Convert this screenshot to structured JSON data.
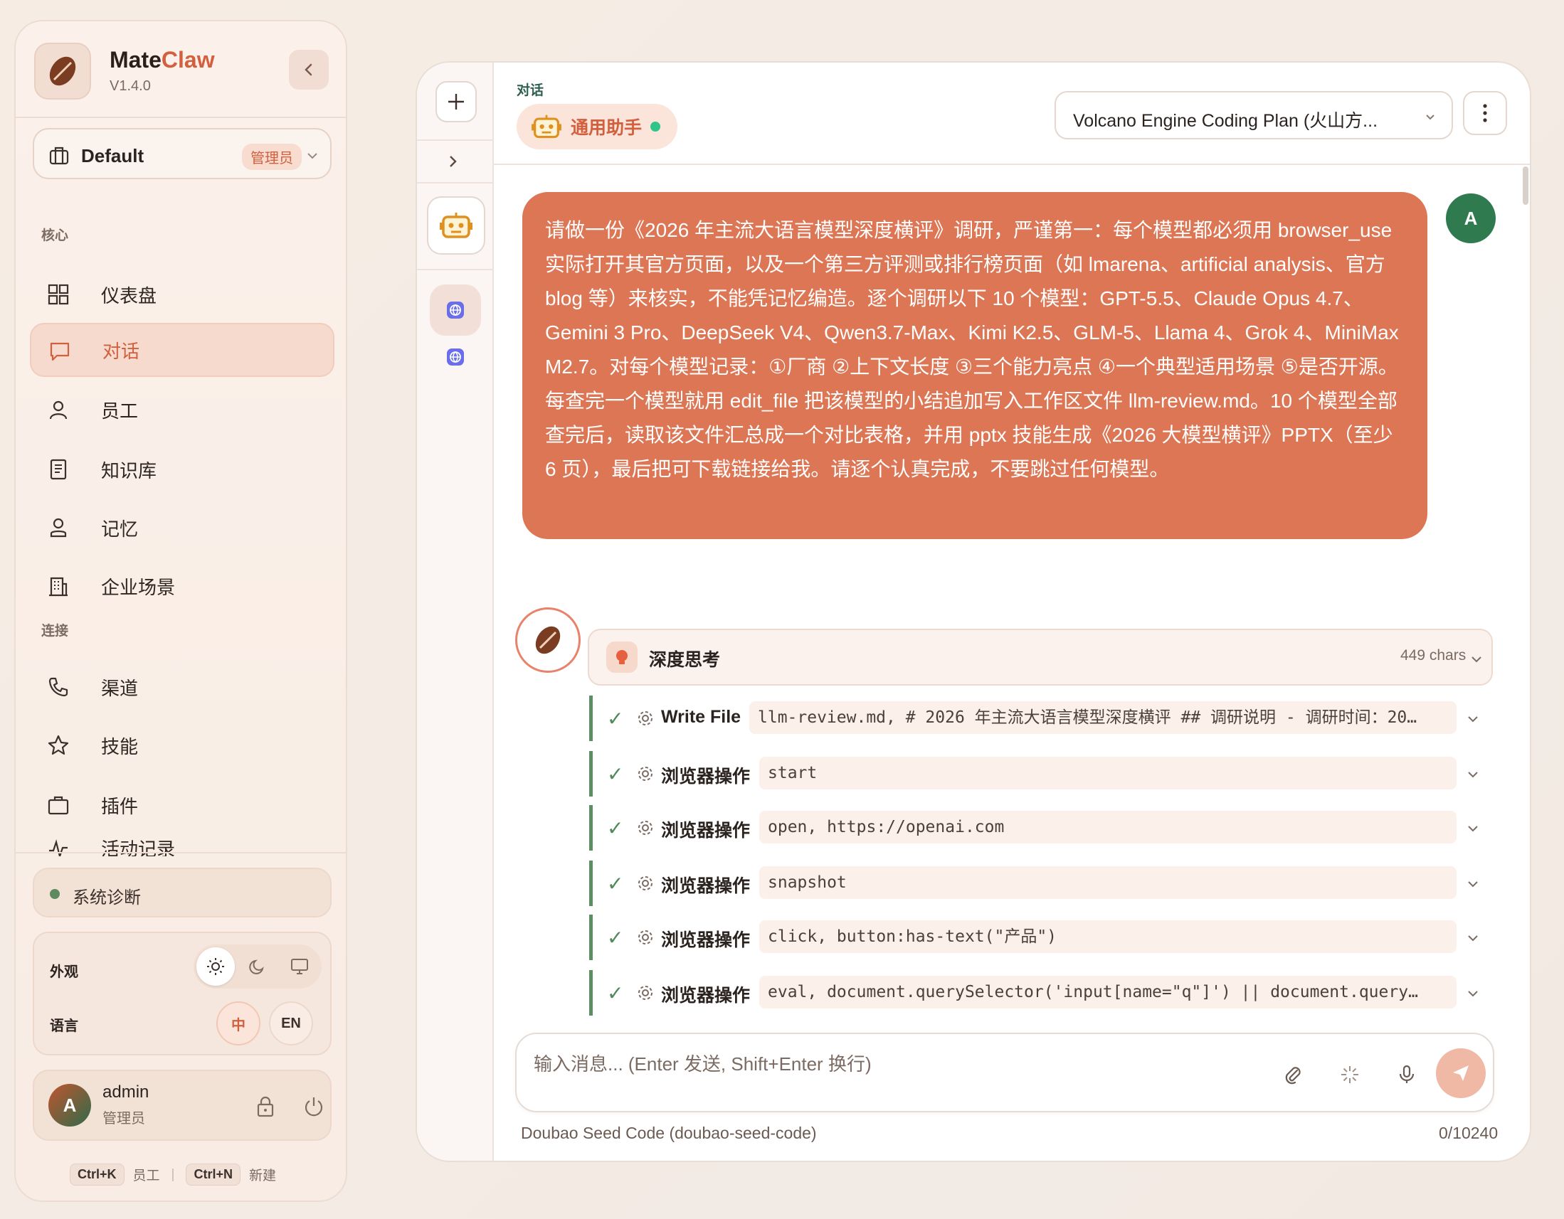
{
  "sidebar": {
    "brand_name_a": "Mate",
    "brand_name_b": "Claw",
    "version": "V1.4.0",
    "workspace": {
      "name": "Default",
      "badge": "管理员"
    },
    "sections": {
      "core": "核心",
      "connect": "连接"
    },
    "items": [
      {
        "label": "仪表盘",
        "icon": "dashboard-icon"
      },
      {
        "label": "对话",
        "icon": "chat-icon",
        "active": true
      },
      {
        "label": "员工",
        "icon": "user-icon"
      },
      {
        "label": "知识库",
        "icon": "book-icon"
      },
      {
        "label": "记忆",
        "icon": "memory-icon"
      },
      {
        "label": "企业场景",
        "icon": "building-icon"
      },
      {
        "label": "渠道",
        "icon": "phone-icon"
      },
      {
        "label": "技能",
        "icon": "star-icon"
      },
      {
        "label": "插件",
        "icon": "briefcase-icon"
      },
      {
        "label": "活动记录",
        "icon": "activity-icon"
      }
    ],
    "diagnostics": "系统诊断",
    "appearance_label": "外观",
    "language_label": "语言",
    "lang_zh": "中",
    "lang_en": "EN",
    "user": {
      "initial": "A",
      "name": "admin",
      "role": "管理员"
    },
    "shortcuts": {
      "k1": "Ctrl+K",
      "l1": "员工",
      "k2": "Ctrl+N",
      "l2": "新建"
    }
  },
  "header": {
    "crumb": "对话",
    "agent_name": "通用助手",
    "model": "Volcano Engine Coding Plan (火山方...",
    "accent": "#d2603e"
  },
  "chat": {
    "user_initial": "A",
    "user_message": "请做一份《2026 年主流大语言模型深度横评》调研，严谨第一：每个模型都必须用 browser_use 实际打开其官方页面，以及一个第三方评测或排行榜页面（如 lmarena、artificial analysis、官方 blog 等）来核实，不能凭记忆编造。逐个调研以下 10 个模型：GPT-5.5、Claude Opus 4.7、Gemini 3 Pro、DeepSeek V4、Qwen3.7-Max、Kimi K2.5、GLM-5、Llama 4、Grok 4、MiniMax M2.7。对每个模型记录：①厂商 ②上下文长度 ③三个能力亮点 ④一个典型适用场景 ⑤是否开源。每查完一个模型就用 edit_file 把该模型的小结追加写入工作区文件 llm-review.md。10 个模型全部查完后，读取该文件汇总成一个对比表格，并用 pptx 技能生成《2026 大模型横评》PPTX（至少 6 页），最后把可下载链接给我。请逐个认真完成，不要跳过任何模型。",
    "thinking": {
      "title": "深度思考",
      "count": "449 chars"
    },
    "tools": [
      {
        "name": "Write File",
        "args": "llm-review.md, # 2026 年主流大语言模型深度横评 ## 调研说明 - 调研时间：20…"
      },
      {
        "name": "浏览器操作",
        "args": "start"
      },
      {
        "name": "浏览器操作",
        "args": "open, https://openai.com"
      },
      {
        "name": "浏览器操作",
        "args": "snapshot"
      },
      {
        "name": "浏览器操作",
        "args": "click, button:has-text(\"产品\")"
      },
      {
        "name": "浏览器操作",
        "args": "eval, document.querySelector('input[name=\"q\"]') || document.query…"
      }
    ]
  },
  "composer": {
    "placeholder": "输入消息... (Enter 发送, Shift+Enter 换行)",
    "model_footer": "Doubao Seed Code (doubao-seed-code)",
    "counter": "0/10240"
  }
}
